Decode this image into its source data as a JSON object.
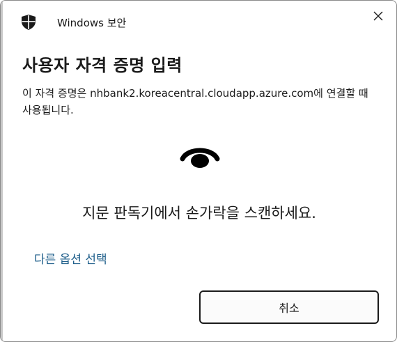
{
  "window": {
    "title": "Windows 보안",
    "app_icon": "shield-icon",
    "close_icon": "close-icon"
  },
  "dialog": {
    "heading": "사용자 자격 증명 입력",
    "description": "이 자격 증명은 nhbank2.koreacentral.cloudapp.azure.com에 연결할 때 사용됩니다.",
    "biometric_icon": "fingerprint-icon",
    "instruction": "지문 판독기에서 손가락을 스캔하세요.",
    "more_options_label": "다른 옵션 선택",
    "cancel_label": "취소"
  },
  "colors": {
    "link": "#1f5f8b",
    "text": "#1a1a1a",
    "background": "#ffffff"
  }
}
